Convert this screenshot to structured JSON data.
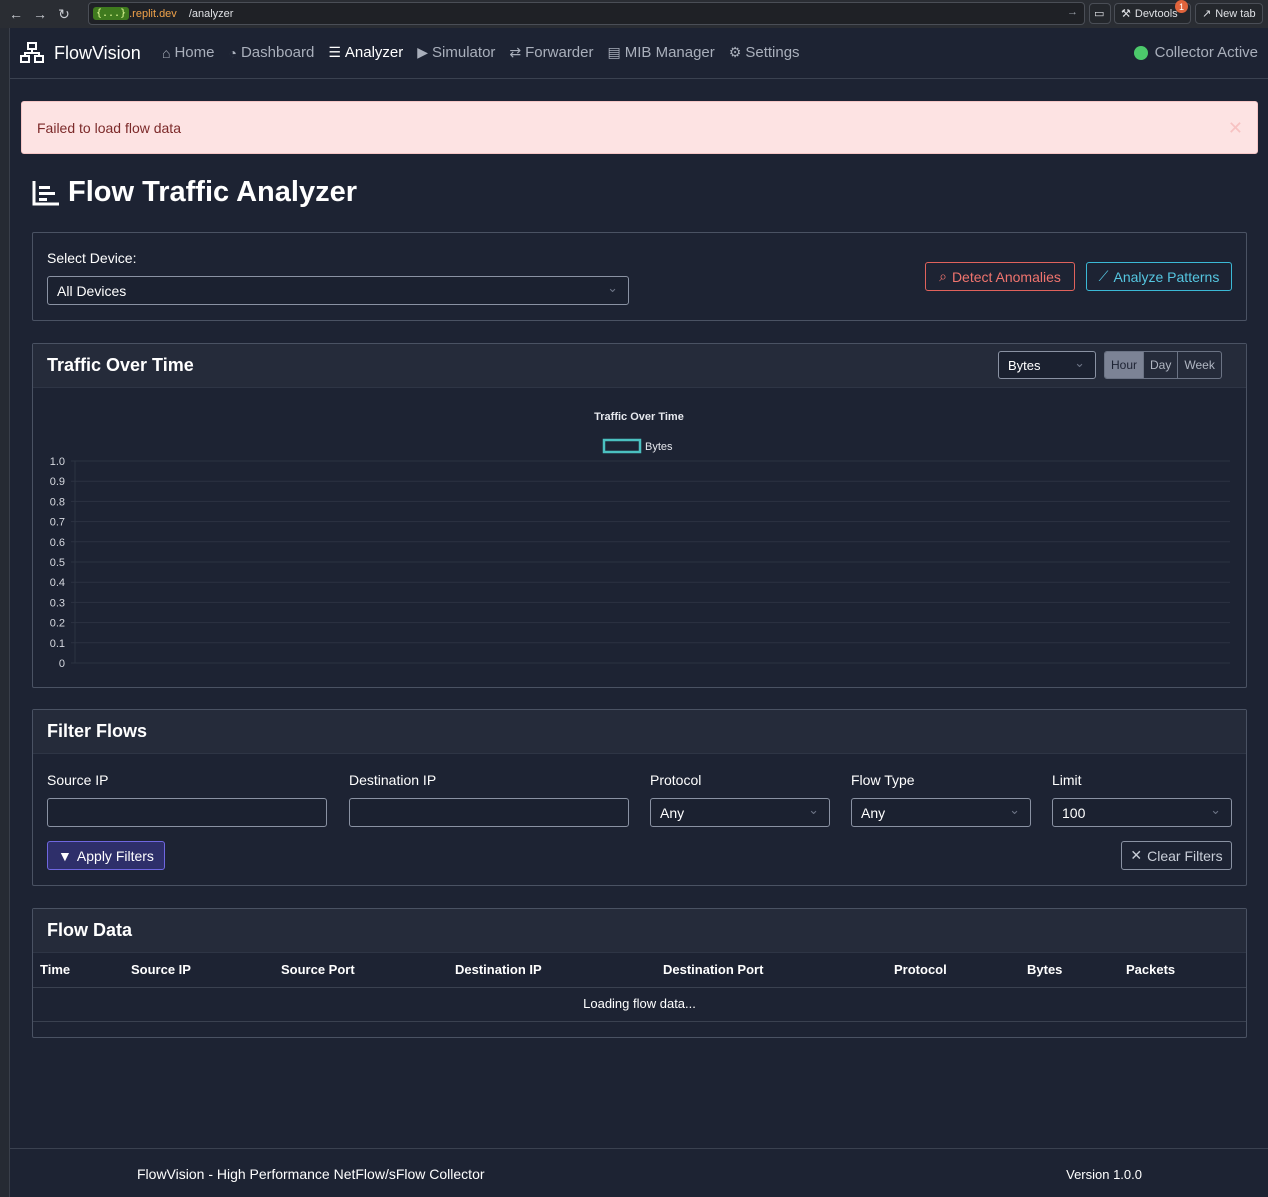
{
  "browser": {
    "url_domain": "{...}",
    "url_host": ".replit.dev",
    "url_path": "/analyzer",
    "devtools_label": "Devtools",
    "devtools_badge": "1",
    "new_tab_label": "New tab"
  },
  "navbar": {
    "brand": "FlowVision",
    "links": [
      {
        "label": "Home",
        "icon": "home-icon"
      },
      {
        "label": "Dashboard",
        "icon": "dashboard-icon"
      },
      {
        "label": "Analyzer",
        "icon": "analyzer-icon"
      },
      {
        "label": "Simulator",
        "icon": "play-icon"
      },
      {
        "label": "Forwarder",
        "icon": "exchange-icon"
      },
      {
        "label": "MIB Manager",
        "icon": "file-icon"
      },
      {
        "label": "Settings",
        "icon": "gear-icon"
      }
    ],
    "active": "Analyzer",
    "status_label": "Collector Active",
    "status_color": "#4cc96b"
  },
  "alert": {
    "message": "Failed to load flow data"
  },
  "page": {
    "title": "Flow Traffic Analyzer"
  },
  "device_panel": {
    "label": "Select Device:",
    "selected": "All Devices",
    "detect_label": "Detect Anomalies",
    "analyze_label": "Analyze Patterns"
  },
  "traffic": {
    "header": "Traffic Over Time",
    "metric_selected": "Bytes",
    "ranges": [
      "Hour",
      "Day",
      "Week"
    ],
    "active_range": "Hour"
  },
  "chart_data": {
    "type": "line",
    "title": "Traffic Over Time",
    "series": [
      {
        "name": "Bytes",
        "values": []
      }
    ],
    "ylim": [
      0,
      1.0
    ],
    "yticks": [
      "1.0",
      "0.9",
      "0.8",
      "0.7",
      "0.6",
      "0.5",
      "0.4",
      "0.3",
      "0.2",
      "0.1",
      "0"
    ],
    "grid": true,
    "legend": "top",
    "series_color": "#4bc0c0"
  },
  "filters": {
    "header": "Filter Flows",
    "source_ip_label": "Source IP",
    "source_ip_value": "",
    "dest_ip_label": "Destination IP",
    "dest_ip_value": "",
    "protocol_label": "Protocol",
    "protocol_value": "Any",
    "flow_type_label": "Flow Type",
    "flow_type_value": "Any",
    "limit_label": "Limit",
    "limit_value": "100",
    "apply_label": "Apply Filters",
    "clear_label": "Clear Filters"
  },
  "flow_table": {
    "header": "Flow Data",
    "columns": [
      "Time",
      "Source IP",
      "Source Port",
      "Destination IP",
      "Destination Port",
      "Protocol",
      "Bytes",
      "Packets"
    ],
    "loading_text": "Loading flow data..."
  },
  "footer": {
    "left": "FlowVision - High Performance NetFlow/sFlow Collector",
    "right": "Version 1.0.0"
  }
}
